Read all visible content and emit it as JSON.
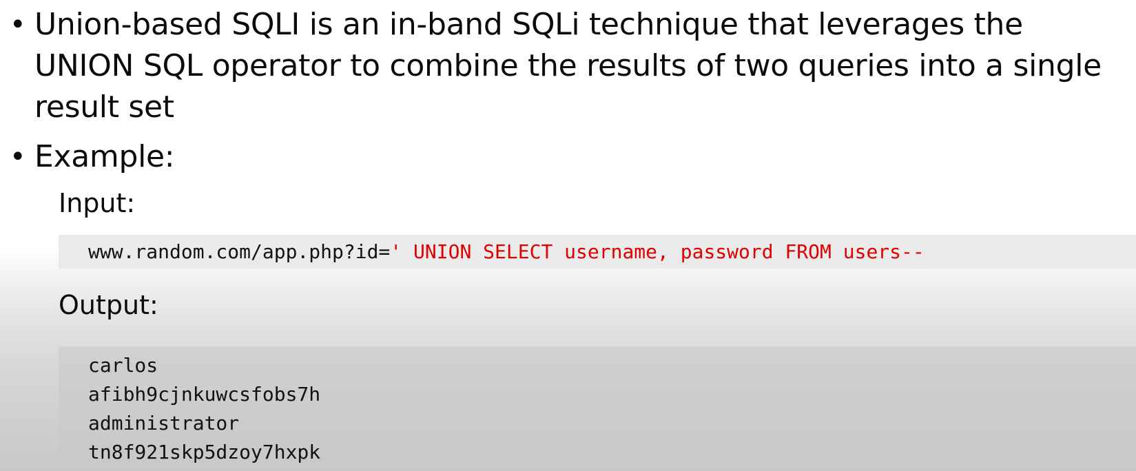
{
  "bullets": [
    {
      "symbol": "•",
      "text": "Union-based SQLI is an in-band SQLi technique that leverages the UNION SQL operator to combine the results of two queries into a single result set"
    },
    {
      "symbol": "•",
      "text": "Example:"
    }
  ],
  "example": {
    "input_label": "Input:",
    "input_url_plain": "www.random.com/app.php?id=",
    "input_url_injection": "' UNION SELECT username, password FROM users--",
    "output_label": "Output:",
    "output_lines": [
      "carlos",
      "afibh9cjnkuwcsfobs7h",
      "administrator",
      "tn8f921skp5dzoy7hxpk"
    ]
  },
  "colors": {
    "injection": "#e00000",
    "text": "#0b0b0b"
  }
}
